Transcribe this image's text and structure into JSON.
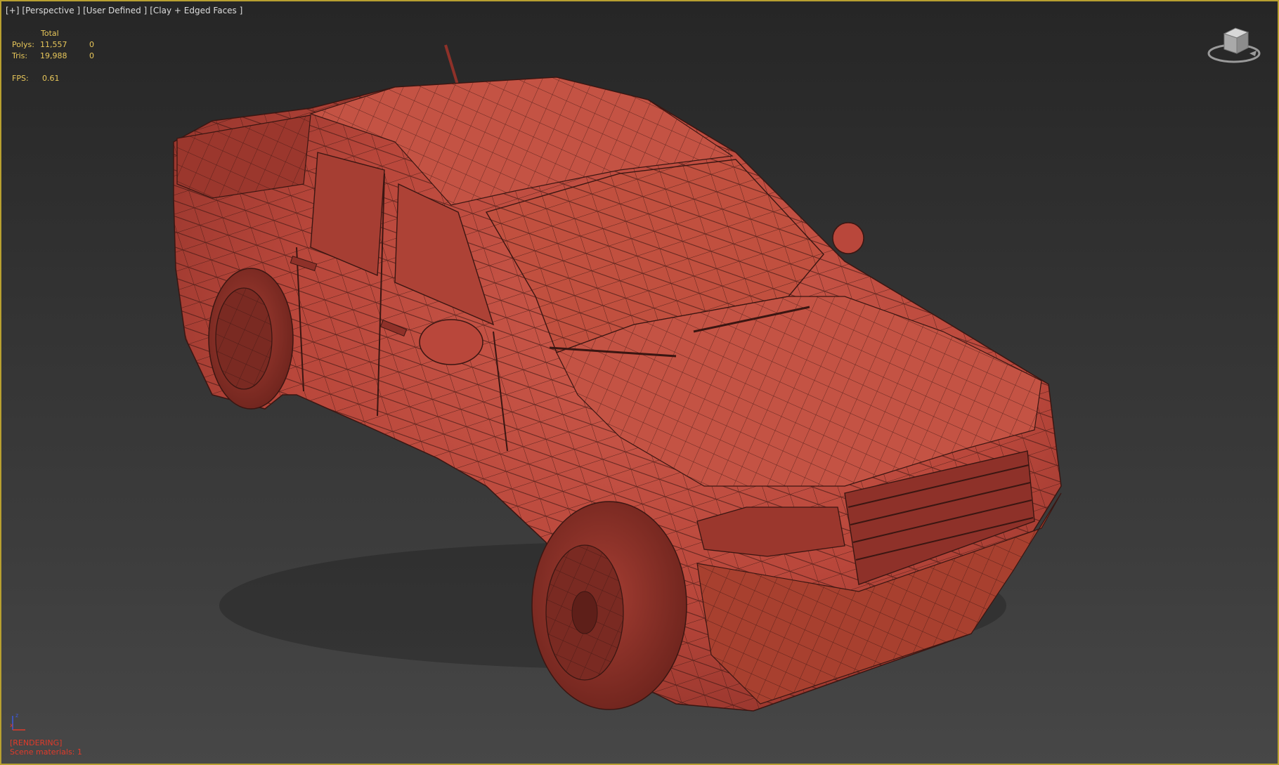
{
  "viewport": {
    "menu": {
      "plus": "[+]",
      "view": "[Perspective ]",
      "shading": "[User Defined ]",
      "style": "[Clay + Edged Faces ]"
    },
    "stats": {
      "header": "Total",
      "rows": [
        {
          "label": "Polys:",
          "total": "11,557",
          "selected": "0"
        },
        {
          "label": "Tris:",
          "total": "19,988",
          "selected": "0"
        }
      ]
    },
    "fps": {
      "label": "FPS:",
      "value": "0.61"
    },
    "axis": {
      "z_label": "z",
      "x_label": "x"
    },
    "bottom_info": {
      "line1": "[RENDERING]",
      "line2": "Scene materials: 1"
    }
  },
  "colors": {
    "clay": "#b9473b",
    "clay_dark": "#8e3129",
    "clay_light": "#cc5a4b",
    "wire": "#3a1612",
    "hud_yellow": "#e8c75a",
    "border": "#b8a030"
  },
  "model": {
    "name": "pickup-truck-mesh",
    "style": "clay-edged-faces"
  }
}
